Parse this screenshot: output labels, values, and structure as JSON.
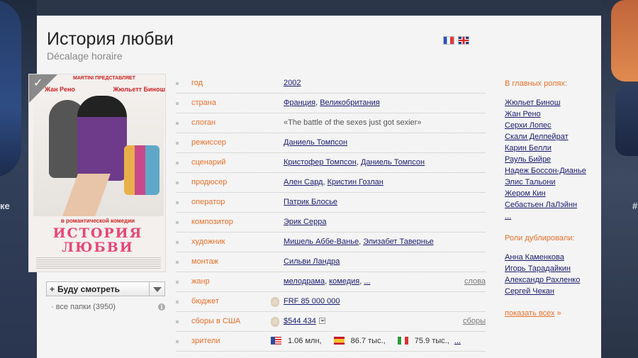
{
  "movie": {
    "title": "История любви",
    "original_title": "Décalage horaire"
  },
  "languages": [
    {
      "name": "fr-flag-icon",
      "colors": [
        "#2a52be",
        "#ffffff",
        "#e23a3a"
      ]
    },
    {
      "name": "gb-flag-icon",
      "colors": [
        "#1e3a8a",
        "#ffffff",
        "#dd2222"
      ]
    }
  ],
  "poster": {
    "brand": "MARTINI ПРЕДСТАВЛЯЕТ",
    "actor_left": "Жан Рено",
    "actor_right": "Жюльетт Бинош",
    "tagline": "в романтической комедии",
    "title_line1": "ИСТОРИЯ",
    "title_line2": "ЛЮБВИ",
    "studio": "STUDIO CANAL"
  },
  "watch": {
    "label": "Буду смотреть",
    "folders": "все папки (3950)"
  },
  "info": {
    "year_label": "год",
    "year": "2002",
    "country_label": "страна",
    "country_1": "Франция",
    "country_2": "Великобритания",
    "slogan_label": "слоган",
    "slogan": "«The battle of the sexes just got sexier»",
    "director_label": "режиссер",
    "director": "Даниель Томпсон",
    "writer_label": "сценарий",
    "writer_1": "Кристофер Томпсон",
    "writer_2": "Даниель Томпсон",
    "producer_label": "продюсер",
    "producer_1": "Ален Сард",
    "producer_2": "Кристин Гозлан",
    "operator_label": "оператор",
    "operator": "Патрик Блосье",
    "composer_label": "композитор",
    "composer": "Эрик Серра",
    "artist_label": "художник",
    "artist_1": "Мишель Аббе-Ванье",
    "artist_2": "Элизабет Тавернье",
    "editing_label": "монтаж",
    "editing": "Сильви Ландра",
    "genre_label": "жанр",
    "genre_1": "мелодрама",
    "genre_2": "комедия",
    "genre_more": "...",
    "genre_link": "слова",
    "budget_label": "бюджет",
    "budget": "FRF 85 000 000",
    "usa_label": "сборы в США",
    "usa": "$544 434",
    "usa_link": "сборы",
    "audience_label": "зрители",
    "audience_us": "1.06 млн,",
    "audience_es": "86.7 тыс.,",
    "audience_it": "75.9 тыс.,",
    "audience_more": "..."
  },
  "cast": {
    "header": "В главных ролях:",
    "actors": [
      "Жюльет Бинош",
      "Жан Рено",
      "Серхи Лопес",
      "Скали Делпейрат",
      "Карин Белли",
      "Рауль Бийре",
      "Надеж Боссон-Дианье",
      "Элис Тальони",
      "Жером Кин",
      "Себастьен ЛаЛэйнн",
      "..."
    ],
    "dub_header": "Роли дублировали:",
    "dubbers": [
      "Анна Каменкова",
      "Игорь Тарадайкин",
      "Александр Рахленко",
      "Сергей Чекан"
    ],
    "show_all": "показать всех",
    "show_all_arrow": "»"
  },
  "background": {
    "left_text": "ке",
    "right_text": "#"
  }
}
